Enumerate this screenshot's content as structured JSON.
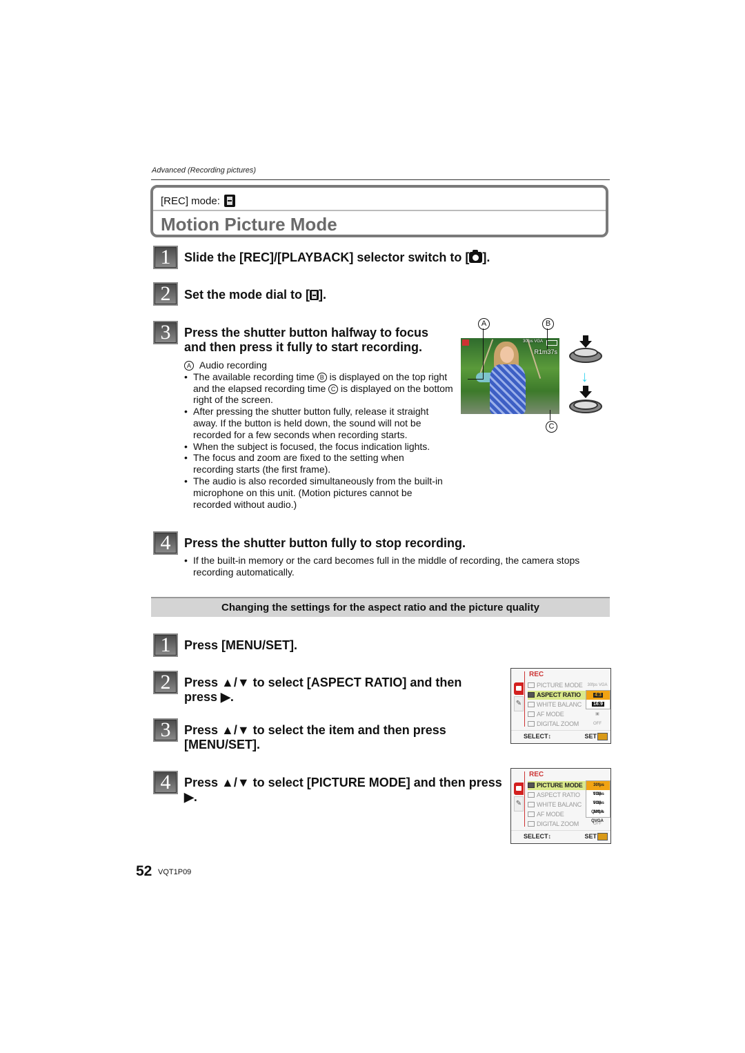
{
  "header": {
    "section_label": "Advanced (Recording pictures)",
    "rec_mode_label": "[REC] mode:",
    "rec_mode_icon": "motion-picture-film-icon",
    "title": "Motion Picture Mode"
  },
  "steps_main": [
    {
      "number": "1",
      "text_before": "Slide the [REC]/[PLAYBACK] selector switch to [",
      "icon": "camera-icon",
      "text_after": "]."
    },
    {
      "number": "2",
      "text_before": "Set the mode dial to [",
      "icon": "motion-picture-film-icon",
      "text_after": "]."
    },
    {
      "number": "3",
      "line1": "Press the shutter button halfway to focus",
      "line2": "and then press it fully to start recording."
    },
    {
      "number": "4",
      "text": "Press the shutter button fully to stop recording."
    }
  ],
  "step3_notes": {
    "callout_a_label": "A",
    "callout_a_text": "Audio recording",
    "bullets": [
      {
        "parts": [
          "The available recording time ",
          "B",
          " is displayed on the top right and the elapsed recording time ",
          "C",
          " is displayed on the bottom right of the screen."
        ]
      },
      {
        "text": "After pressing the shutter button fully, release it straight away. If the button is held down, the sound will not be recorded for a few seconds when recording starts."
      },
      {
        "text": "When the subject is focused, the focus indication lights."
      },
      {
        "text": "The focus and zoom are fixed to the setting when recording starts (the first frame)."
      },
      {
        "text": "The audio is also recorded simultaneously from the built-in microphone on this unit. (Motion pictures cannot be recorded without audio.)"
      }
    ]
  },
  "illustration": {
    "callouts": [
      "A",
      "B",
      "C"
    ],
    "osd_remaining_time": "R1m37s",
    "osd_quality": "30fps VGA",
    "arrow_color": "#3ad6f0"
  },
  "step4_notes": {
    "bullets": [
      {
        "text": "If the built-in memory or the card becomes full in the middle of recording, the camera stops recording automatically."
      }
    ]
  },
  "banner": {
    "text": "Changing the settings for the aspect ratio and the picture quality"
  },
  "steps_settings": [
    {
      "number": "1",
      "text": "Press [MENU/SET]."
    },
    {
      "number": "2",
      "line1": "Press ▲/▼ to select [ASPECT RATIO] and then",
      "line2": "press ▶."
    },
    {
      "number": "3",
      "line1": "Press ▲/▼ to select the item and then press",
      "line2": "[MENU/SET]."
    },
    {
      "number": "4",
      "line1": "Press ▲/▼ to select [PICTURE MODE] and then press",
      "line2": "▶."
    }
  ],
  "menu_screens": [
    {
      "title": "REC",
      "rows": [
        "PICTURE MODE",
        "ASPECT RATIO",
        "WHITE BALANC",
        "AF MODE",
        "DIGITAL ZOOM"
      ],
      "active_row": 1,
      "values": [
        "30fps VGA",
        "",
        "",
        "▣",
        "OFF"
      ],
      "popup_options": [
        "4:3",
        "16:9"
      ],
      "popup_selected": 0,
      "select_label": "SELECT↕",
      "set_label": "SET"
    },
    {
      "title": "REC",
      "rows": [
        "PICTURE MODE",
        "ASPECT RATIO",
        "WHITE BALANC",
        "AF MODE",
        "DIGITAL ZOOM"
      ],
      "active_row": 0,
      "values": [
        "",
        "",
        "",
        "",
        "OFF"
      ],
      "popup_options": [
        "30fps VGA",
        "10fps VGA",
        "30fps QVGA",
        "10fps QVGA"
      ],
      "popup_selected": 0,
      "select_label": "SELECT↕",
      "set_label": "SET"
    }
  ],
  "footer": {
    "page_number": "52",
    "doc_code": "VQT1P09"
  }
}
